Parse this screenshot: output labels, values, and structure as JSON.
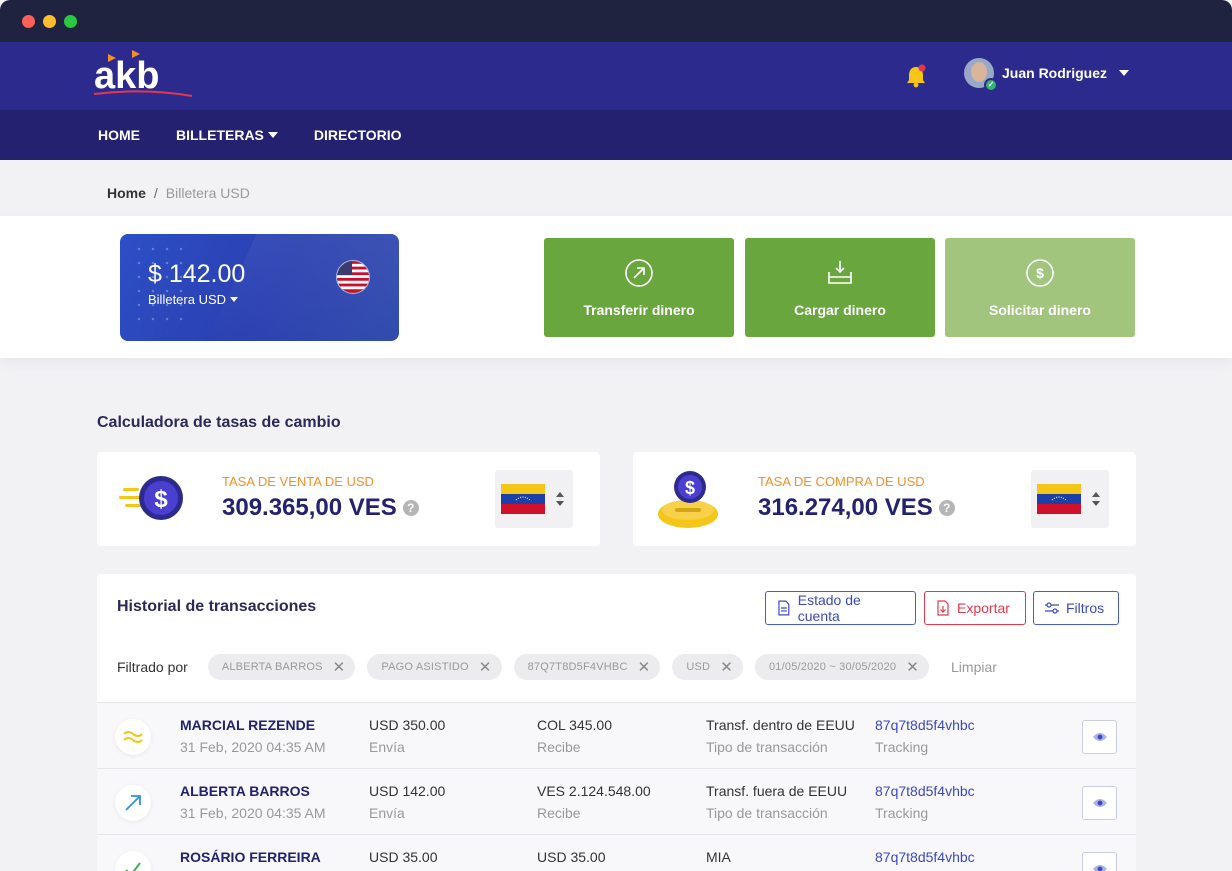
{
  "brand": {
    "logo_text": "akb"
  },
  "user": {
    "name": "Juan Rodriguez"
  },
  "nav": {
    "items": [
      {
        "label": "HOME"
      },
      {
        "label": "BILLETERAS"
      },
      {
        "label": "DIRECTORIO"
      }
    ]
  },
  "breadcrumb": {
    "home": "Home",
    "separator": "/",
    "current": "Billetera USD"
  },
  "wallet": {
    "amount": "$ 142.00",
    "label": "Billetera USD"
  },
  "actions": [
    {
      "label": "Transferir dinero",
      "icon": "arrow-up-right-circle-icon"
    },
    {
      "label": "Cargar dinero",
      "icon": "tray-download-icon"
    },
    {
      "label": "Solicitar dinero",
      "icon": "dollar-circle-icon"
    }
  ],
  "calculator": {
    "title": "Calculadora de tasas de cambio",
    "sell": {
      "label": "TASA DE VENTA DE USD",
      "value": "309.365,00 VES"
    },
    "buy": {
      "label": "TASA DE COMPRA DE USD",
      "value": "316.274,00 VES"
    }
  },
  "transactions": {
    "title": "Historial de transacciones",
    "buttons": {
      "statement": "Estado de cuenta",
      "export": "Exportar",
      "filters": "Filtros"
    },
    "filter_label": "Filtrado por",
    "chips": [
      "ALBERTA BARROS",
      "PAGO ASISTIDO",
      "87Q7T8D5F4VHBC",
      "USD",
      "01/05/2020 ~ 30/05/2020"
    ],
    "clear_label": "Limpiar",
    "rows": [
      {
        "icon": "approx-icon",
        "name": "MARCIAL REZENDE",
        "date": "31 Feb, 2020 04:35 AM",
        "sent": "USD 350.00",
        "sent_label": "Envía",
        "received": "COL 345.00",
        "received_label": "Recibe",
        "type": "Transf. dentro de EEUU",
        "type_label": "Tipo de transacción",
        "tracking": "87q7t8d5f4vhbc",
        "tracking_label": "Tracking"
      },
      {
        "icon": "arrow-up-right-icon",
        "name": "ALBERTA BARROS",
        "date": "31 Feb, 2020 04:35 AM",
        "sent": "USD 142.00",
        "sent_label": "Envía",
        "received": "VES 2.124.548.00",
        "received_label": "Recibe",
        "type": "Transf. fuera de EEUU",
        "type_label": "Tipo de transacción",
        "tracking": "87q7t8d5f4vhbc",
        "tracking_label": "Tracking"
      },
      {
        "icon": "check-icon",
        "name": "ROSÁRIO FERREIRA",
        "date": "",
        "sent": "USD 35.00",
        "sent_label": "",
        "received": "USD 35.00",
        "received_label": "",
        "type": "MIA",
        "type_label": "",
        "tracking": "87q7t8d5f4vhbc",
        "tracking_label": ""
      }
    ]
  },
  "colors": {
    "header": "#2d2a8e",
    "navbar": "#232170",
    "action_green": "#6aa63e",
    "action_green_light": "#a2c57e",
    "accent_orange": "#f2902b",
    "link_blue": "#3b48c4",
    "export_red": "#e0394b"
  }
}
